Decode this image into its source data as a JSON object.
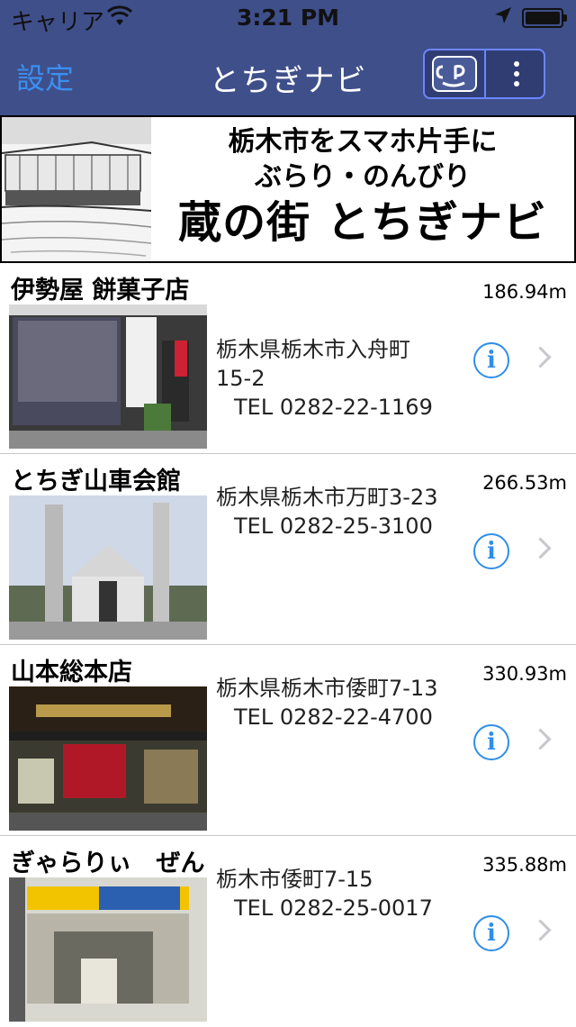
{
  "status": {
    "carrier": "キャリア",
    "time": "3:21 PM"
  },
  "nav": {
    "settings": "設定",
    "title": "とちぎナビ",
    "cp_icon": "cp-logo-icon",
    "more_icon": "more-vertical-icon"
  },
  "banner": {
    "line1": "栃木市をスマホ片手に",
    "line2": "ぶらり・のんびり",
    "line3": "蔵の街 とちぎナビ"
  },
  "items": [
    {
      "name": "伊勢屋 餅菓子店",
      "distance": "186.94m",
      "address_line1": "栃木県栃木市入舟町",
      "address_line2": "15-2",
      "tel": "TEL 0282-22-1169"
    },
    {
      "name": "とちぎ山車会館",
      "distance": "266.53m",
      "address_line1": "栃木県栃木市万町3-23",
      "tel": "TEL 0282-25-3100"
    },
    {
      "name": "山本総本店",
      "distance": "330.93m",
      "address_line1": "栃木県栃木市倭町7-13",
      "tel": "TEL 0282-22-4700"
    },
    {
      "name": "ぎゃらりぃ　ぜん",
      "distance": "335.88m",
      "address_line1": "栃木市倭町7-15",
      "tel": "TEL 0282-25-0017"
    }
  ],
  "colors": {
    "nav_bg": "#3f4f8a",
    "accent_blue": "#2f8ee8",
    "settings_blue": "#3b8ff0"
  }
}
